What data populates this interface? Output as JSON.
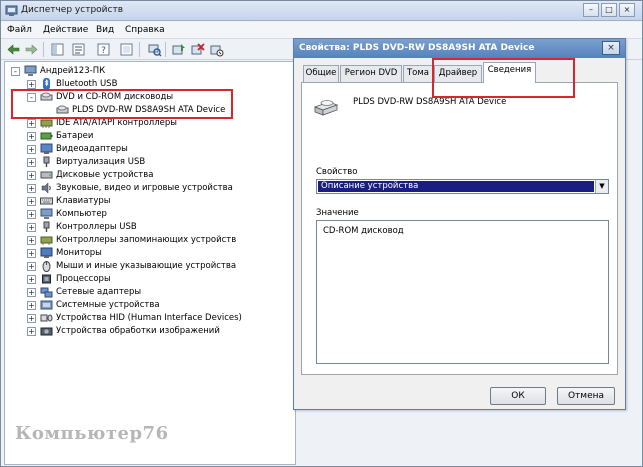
{
  "window": {
    "title": "Диспетчер устройств"
  },
  "menu": {
    "items": [
      "Файл",
      "Действие",
      "Вид",
      "Справка"
    ]
  },
  "tree": {
    "root": "Андрей123-ПК",
    "items": [
      {
        "label": "Bluetooth USB",
        "expander": "+"
      },
      {
        "label": "DVD и CD-ROM дисководы",
        "expander": "-"
      },
      {
        "label": "PLDS DVD-RW DS8A9SH ATA Device",
        "child": true
      },
      {
        "label": "IDE ATA/ATAPI контроллеры",
        "expander": "+"
      },
      {
        "label": "Батареи",
        "expander": "+"
      },
      {
        "label": "Видеоадаптеры",
        "expander": "+"
      },
      {
        "label": "Виртуализация USB",
        "expander": "+"
      },
      {
        "label": "Дисковые устройства",
        "expander": "+"
      },
      {
        "label": "Звуковые, видео и игровые устройства",
        "expander": "+"
      },
      {
        "label": "Клавиатуры",
        "expander": "+"
      },
      {
        "label": "Компьютер",
        "expander": "+"
      },
      {
        "label": "Контроллеры USB",
        "expander": "+"
      },
      {
        "label": "Контроллеры запоминающих устройств",
        "expander": "+"
      },
      {
        "label": "Мониторы",
        "expander": "+"
      },
      {
        "label": "Мыши и иные указывающие устройства",
        "expander": "+"
      },
      {
        "label": "Процессоры",
        "expander": "+"
      },
      {
        "label": "Сетевые адаптеры",
        "expander": "+"
      },
      {
        "label": "Системные устройства",
        "expander": "+"
      },
      {
        "label": "Устройства HID (Human Interface Devices)",
        "expander": "+"
      },
      {
        "label": "Устройства обработки изображений",
        "expander": "+"
      }
    ]
  },
  "dialog": {
    "title": "Свойства: PLDS DVD-RW DS8A9SH ATA Device",
    "tabs": [
      "Общие",
      "Регион DVD",
      "Тома",
      "Драйвер",
      "Сведения"
    ],
    "active_tab": "Сведения",
    "device_name": "PLDS DVD-RW DS8A9SH ATA Device",
    "property_label": "Свойство",
    "property_value": "Описание устройства",
    "value_label": "Значение",
    "value_text": "CD-ROM дисковод",
    "ok_label": "ОК",
    "cancel_label": "Отмена"
  },
  "watermark": "Компьютер76",
  "highlight_color": "#d7262d"
}
